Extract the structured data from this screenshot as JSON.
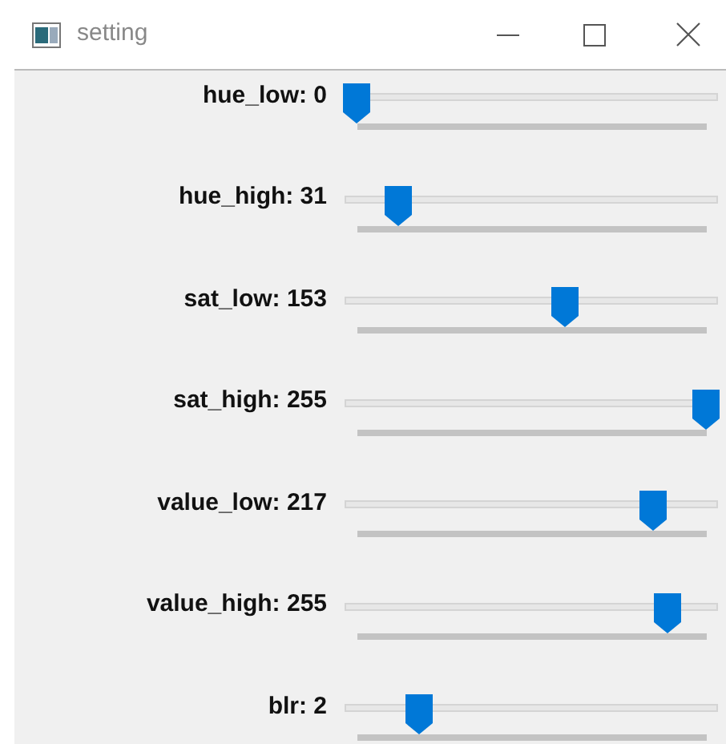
{
  "window": {
    "title": "setting"
  },
  "sliders": [
    {
      "label": "hue_low: 0",
      "level": 0
    },
    {
      "label": "hue_high: 31",
      "level": 0.122
    },
    {
      "label": "sat_low: 153",
      "level": 0.6
    },
    {
      "label": "sat_high: 255",
      "level": 1
    },
    {
      "label": "value_low: 217",
      "level": 0.851
    },
    {
      "label": "value_high: 255",
      "level": 0.89
    },
    {
      "label": "blr: 2",
      "level": 0.18
    }
  ]
}
